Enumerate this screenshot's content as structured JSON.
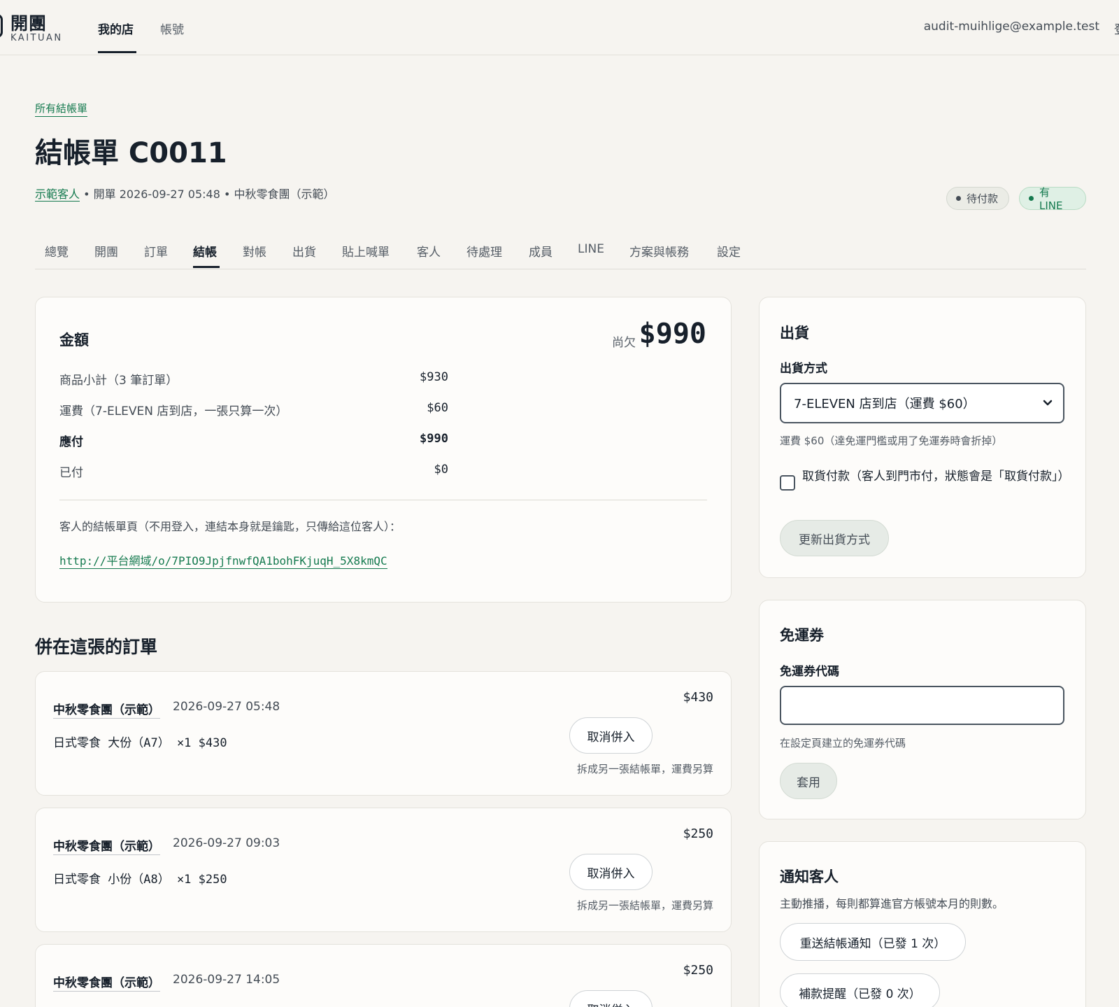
{
  "topbar": {
    "logo_cn": "開團",
    "logo_en": "KAITUAN",
    "nav": [
      {
        "label": "我的店",
        "active": true
      },
      {
        "label": "帳號",
        "active": false
      }
    ],
    "user_email": "audit-muihlige@example.test",
    "user_trailing": "登"
  },
  "header": {
    "breadcrumb": "所有結帳單",
    "title": "結帳單 C0011",
    "customer_link": "示範客人",
    "meta_rest": " • 開單 2026-09-27 05:48 • 中秋零食團（示範）",
    "badges": [
      {
        "label": "待付款",
        "color": "#444c55"
      },
      {
        "label": "有 LINE",
        "color": "#157a4f"
      }
    ]
  },
  "tabs": [
    {
      "label": "總覽"
    },
    {
      "label": "開團"
    },
    {
      "label": "訂單"
    },
    {
      "label": "結帳",
      "active": true
    },
    {
      "label": "對帳"
    },
    {
      "label": "出貨"
    },
    {
      "label": "貼上喊單"
    },
    {
      "label": "客人"
    },
    {
      "label": "待處理"
    },
    {
      "label": "成員"
    },
    {
      "label": "LINE"
    },
    {
      "label": "方案與帳務"
    },
    {
      "label": "設定"
    }
  ],
  "amount": {
    "title": "金額",
    "owed_label": "尚欠",
    "owed_value": "$990",
    "rows": [
      {
        "label": "商品小計（3 筆訂單）",
        "value": "$930"
      },
      {
        "label": "運費（7-ELEVEN 店到店，一張只算一次）",
        "value": "$60"
      },
      {
        "label": "應付",
        "value": "$990"
      },
      {
        "label": "已付",
        "value": "$0"
      }
    ],
    "link_caption": "客人的結帳單頁（不用登入，連結本身就是鑰匙，只傳給這位客人）：",
    "link_prefix": "http://",
    "link_domain": "平台網域",
    "link_path": "/o/7PIO9JpjfnwfQA1bohFKjuqH_5X8kmQC"
  },
  "orders": {
    "title": "併在這張的訂單",
    "items": [
      {
        "shop": "中秋零食團（示範）",
        "time": "2026-09-27 05:48",
        "items": "日式零食 大份（A7） ×1  $430",
        "total": "$430",
        "cancel_label": "取消併入",
        "note": "拆成另一張結帳單，運費另算"
      },
      {
        "shop": "中秋零食團（示範）",
        "time": "2026-09-27 09:03",
        "items": "日式零食 小份（A8） ×1  $250",
        "total": "$250",
        "cancel_label": "取消併入",
        "note": "拆成另一張結帳單，運費另算"
      },
      {
        "shop": "中秋零食團（示範）",
        "time": "2026-09-27 14:05",
        "total": "$250",
        "cancel_label": "取消併入"
      }
    ]
  },
  "shipping": {
    "title": "出貨",
    "method_label": "出貨方式",
    "method_value": "7-ELEVEN 店到店（運費 $60）",
    "fee_help": "運費 $60（達免運門檻或用了免運券時會折掉）",
    "cod_label": "取貨付款（客人到門市付，狀態會是「取貨付款」）",
    "cod_checked": false,
    "update_label": "更新出貨方式"
  },
  "coupon": {
    "title": "免運券",
    "code_label": "免運券代碼",
    "code_value": "",
    "help": "在設定頁建立的免運券代碼",
    "apply_label": "套用"
  },
  "notify": {
    "title": "通知客人",
    "desc": "主動推播，每則都算進官方帳號本月的則數。",
    "resend_label": "重送結帳通知（已發 1 次）",
    "remind_label": "補款提醒（已發 0 次）"
  }
}
